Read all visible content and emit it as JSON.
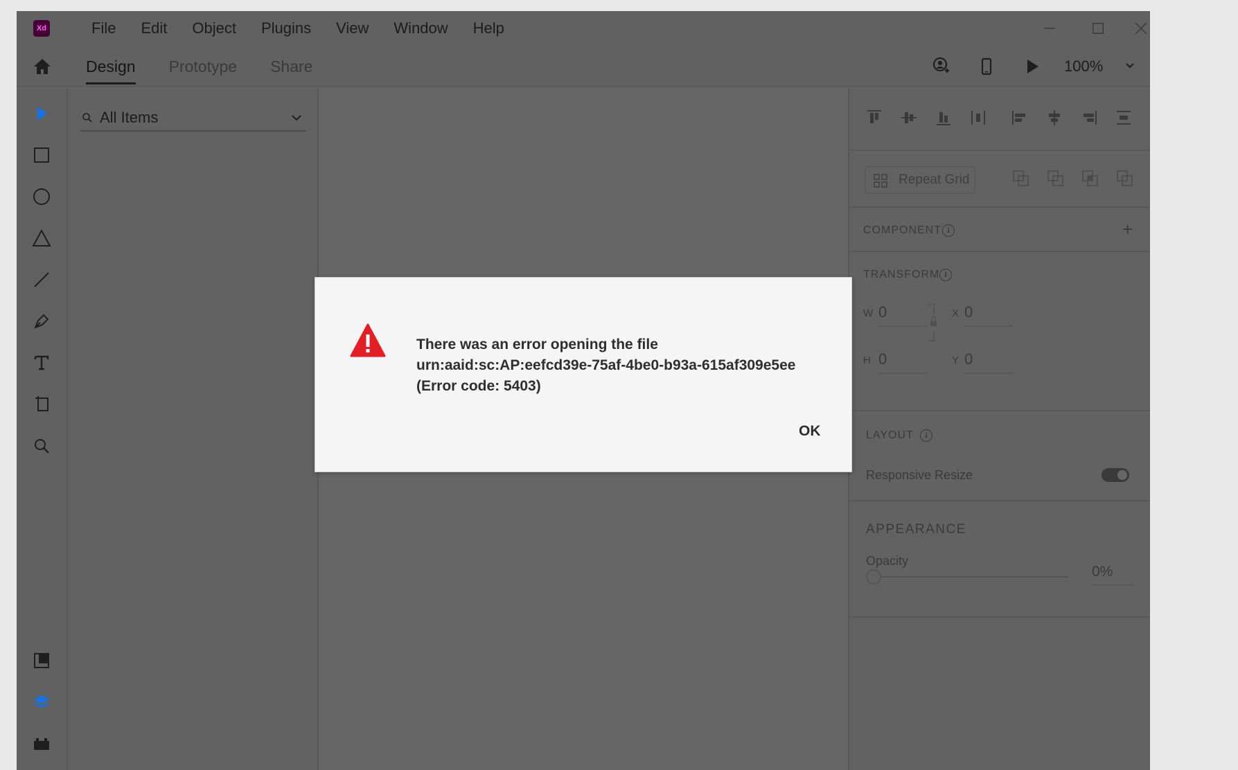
{
  "app": {
    "logo_text": "Xd",
    "brand_color": "#ff61f6"
  },
  "menu": {
    "items": [
      "File",
      "Edit",
      "Object",
      "Plugins",
      "View",
      "Window",
      "Help"
    ]
  },
  "tabs": [
    {
      "label": "Design",
      "active": true
    },
    {
      "label": "Prototype",
      "active": false
    },
    {
      "label": "Share",
      "active": false
    }
  ],
  "topbar": {
    "zoom": "100%"
  },
  "layers": {
    "search_value": "All Items"
  },
  "props": {
    "repeat_grid_label": "Repeat Grid",
    "component_label": "COMPONENT",
    "transform_label": "TRANSFORM",
    "w_label": "W",
    "w_value": "0",
    "x_label": "X",
    "x_value": "0",
    "h_label": "H",
    "h_value": "0",
    "y_label": "Y",
    "y_value": "0",
    "layout_label": "LAYOUT",
    "responsive_label": "Responsive Resize",
    "responsive_on": true,
    "appearance_label": "APPEARANCE",
    "opacity_label": "Opacity",
    "opacity_value": "0%"
  },
  "dialog": {
    "line1": "There was an error opening the file",
    "line2": "urn:aaid:sc:AP:eefcd39e-75af-4be0-b93a-615af309e5ee",
    "line3": "(Error code: 5403)",
    "ok_label": "OK",
    "warning_color": "#e31e24"
  }
}
